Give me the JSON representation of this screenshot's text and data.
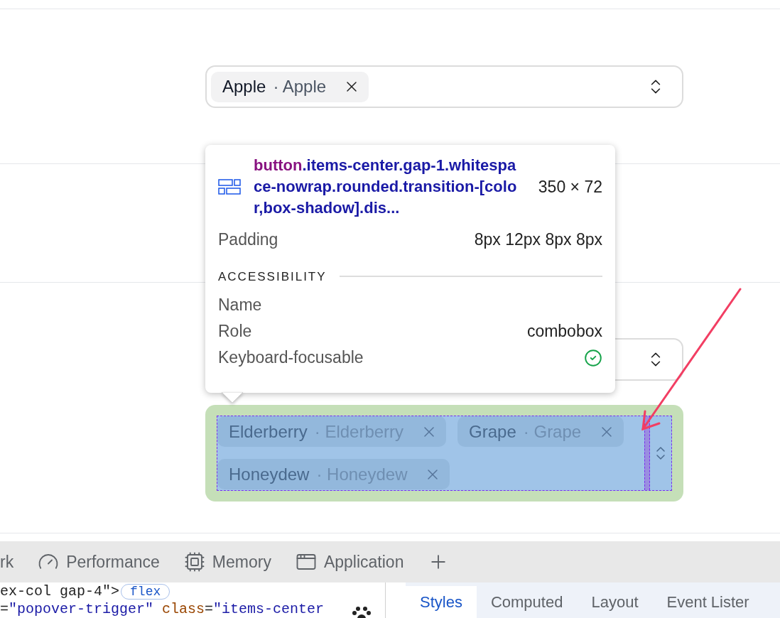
{
  "comboboxes": [
    {
      "highlighted": false,
      "tags": [
        {
          "label": "Apple",
          "value": "· Apple"
        }
      ]
    },
    {
      "highlighted": false
    },
    {
      "highlighted": true,
      "tags": [
        {
          "label": "Elderberry",
          "value": "· Elderberry"
        },
        {
          "label": "Grape",
          "value": "· Grape"
        },
        {
          "label": "Honeydew",
          "value": "· Honeydew"
        }
      ]
    }
  ],
  "inspector_tooltip": {
    "element_tag": "button",
    "element_classes": ".items-center.gap-1.whitespace-nowrap.rounded.transition-[color,box-shadow].dis...",
    "size": "350 × 72",
    "padding_label": "Padding",
    "padding_value": "8px 12px 8px 8px",
    "section_title": "ACCESSIBILITY",
    "rows": [
      {
        "kind": "text",
        "label": "Name"
      },
      {
        "kind": "text",
        "label": "Role",
        "value": "combobox"
      },
      {
        "kind": "check",
        "label": "Keyboard-focusable"
      }
    ]
  },
  "devtools": {
    "tabs": [
      {
        "label": "rk"
      },
      {
        "label": "Performance"
      },
      {
        "label": "Memory"
      },
      {
        "label": "Application"
      }
    ],
    "code_lines": [
      {
        "parts": [
          {
            "kind": "plain",
            "text": "ex-col gap-4\""
          },
          {
            "kind": "plain",
            "text": ">"
          }
        ],
        "badge": "flex"
      },
      {
        "parts": [
          {
            "kind": "plain",
            "text": "="
          },
          {
            "kind": "value",
            "text": "\"popover-trigger\""
          },
          {
            "kind": "attr",
            "text": " class"
          },
          {
            "kind": "plain",
            "text": "="
          },
          {
            "kind": "value",
            "text": "\"items-center"
          }
        ]
      }
    ],
    "side_tabs": [
      {
        "label": "Styles",
        "selected": true
      },
      {
        "label": "Computed",
        "selected": false
      },
      {
        "label": "Layout",
        "selected": false
      },
      {
        "label": "Event Lister",
        "selected": false
      }
    ]
  }
}
